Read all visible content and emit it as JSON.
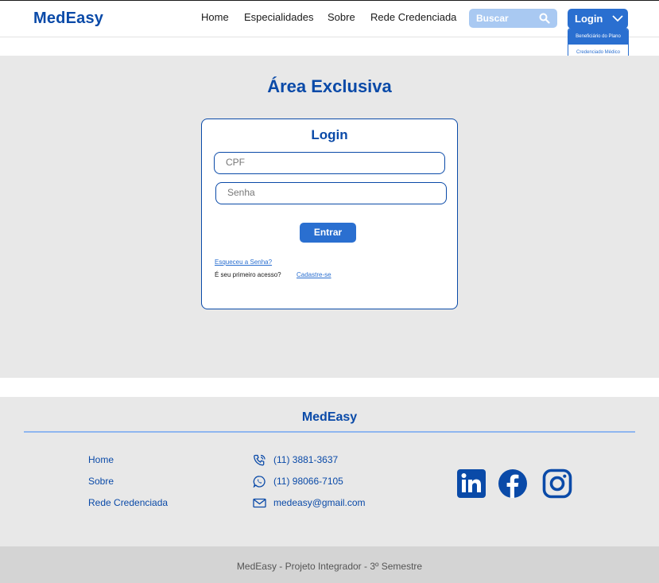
{
  "header": {
    "logo": "MedEasy",
    "nav": [
      "Home",
      "Especialidades",
      "Sobre",
      "Rede Credenciada"
    ],
    "search_placeholder": "Buscar",
    "login_label": "Login",
    "dropdown": [
      "Beneficiário do Plano",
      "Credenciado Médico"
    ]
  },
  "main": {
    "title": "Área Exclusiva",
    "card_title": "Login",
    "cpf_placeholder": "CPF",
    "password_placeholder": "Senha",
    "submit_label": "Entrar",
    "forgot_label": "Esqueceu a Senha?",
    "first_access_text": "É seu primeiro acesso?",
    "signup_label": "Cadastre-se"
  },
  "footer": {
    "logo": "MedEasy",
    "links": [
      "Home",
      "Sobre",
      "Rede Credenciada"
    ],
    "phone": "(11) 3881-3637",
    "whatsapp": "(11) 98066-7105",
    "email": "medeasy@gmail.com",
    "social_icons": [
      "linkedin-icon",
      "facebook-icon",
      "instagram-icon"
    ],
    "bottom_text": "MedEasy - Projeto Integrador - 3º Semestre"
  },
  "colors": {
    "brand": "#0a4aa8",
    "accent": "#2a6fd0",
    "search_bg": "#a9c9f2",
    "panel_bg": "#e8e8e8"
  }
}
